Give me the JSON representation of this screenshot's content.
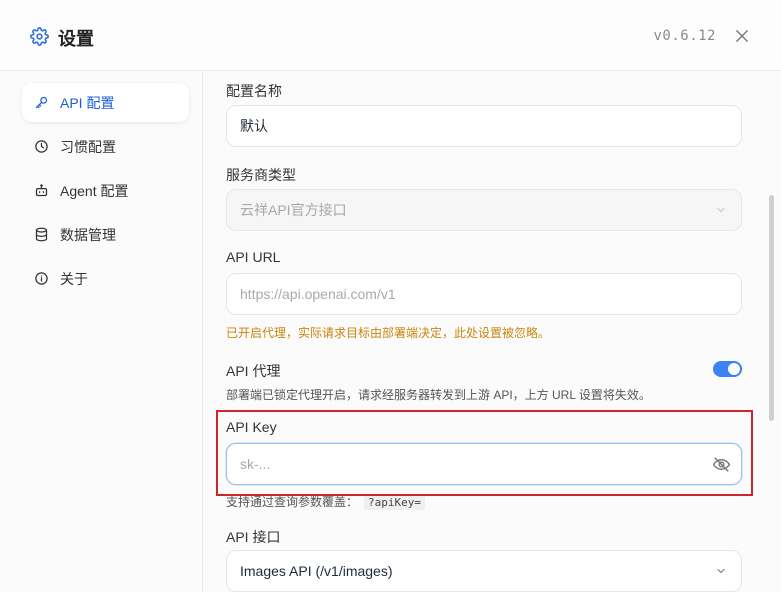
{
  "header": {
    "title": "设置",
    "version": "v0.6.12"
  },
  "sidebar": {
    "items": [
      {
        "label": "API 配置",
        "icon": "key-icon",
        "active": true
      },
      {
        "label": "习惯配置",
        "icon": "clock-icon",
        "active": false
      },
      {
        "label": "Agent 配置",
        "icon": "bot-icon",
        "active": false
      },
      {
        "label": "数据管理",
        "icon": "database-icon",
        "active": false
      },
      {
        "label": "关于",
        "icon": "info-icon",
        "active": false
      }
    ]
  },
  "form": {
    "config_name": {
      "label": "配置名称",
      "value": "默认"
    },
    "provider": {
      "label": "服务商类型",
      "value": "云祥API官方接口"
    },
    "api_url": {
      "label": "API URL",
      "placeholder": "https://api.openai.com/v1",
      "warning": "已开启代理，实际请求目标由部署端决定，此处设置被忽略。"
    },
    "api_proxy": {
      "label": "API 代理",
      "enabled": true,
      "hint": "部署端已锁定代理开启，请求经服务器转发到上游 API，上方 URL 设置将失效。"
    },
    "api_key": {
      "label": "API Key",
      "placeholder": "sk-...",
      "hint": "支持通过查询参数覆盖：",
      "hint_code": "?apiKey="
    },
    "api_endpoint": {
      "label": "API 接口",
      "value": "Images API (/v1/images)"
    }
  },
  "colors": {
    "accent": "#3b82f6",
    "active_nav": "#1a5fd8",
    "warning": "#c8860d",
    "highlight": "#d0242b"
  }
}
